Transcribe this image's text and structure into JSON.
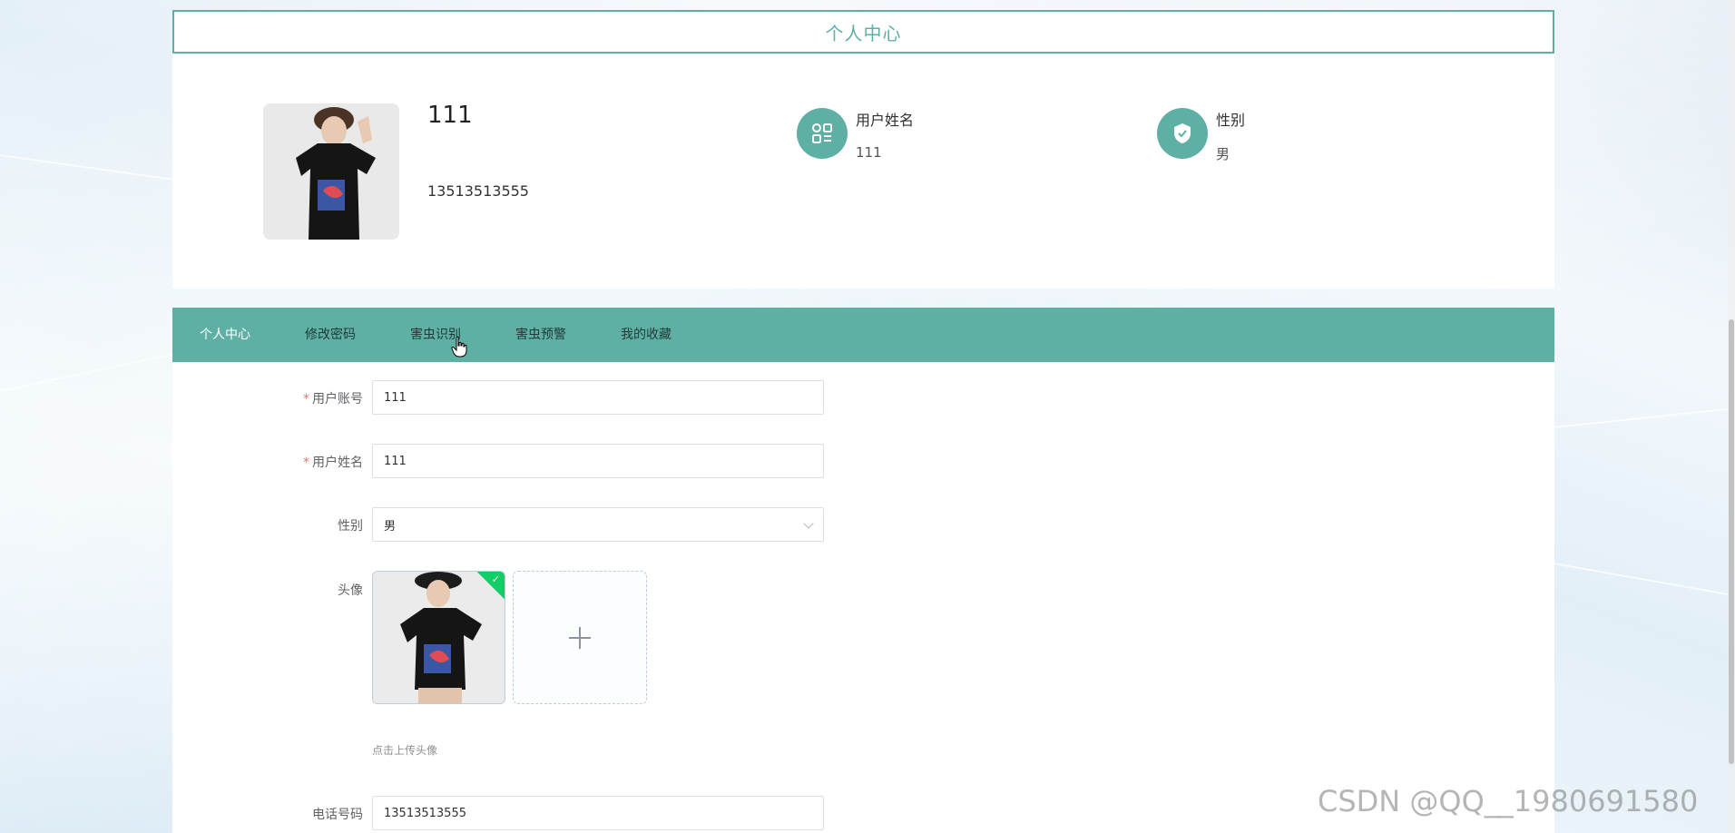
{
  "page": {
    "title": "个人中心"
  },
  "profile": {
    "name": "111",
    "phone": "13513513555",
    "info": [
      {
        "label": "用户姓名",
        "value": "111",
        "icon": "grid-icon"
      },
      {
        "label": "性别",
        "value": "男",
        "icon": "shield-check-icon"
      }
    ]
  },
  "tabs": [
    {
      "label": "个人中心",
      "active": true
    },
    {
      "label": "修改密码",
      "active": false
    },
    {
      "label": "害虫识别",
      "active": false
    },
    {
      "label": "害虫预警",
      "active": false
    },
    {
      "label": "我的收藏",
      "active": false
    }
  ],
  "form": {
    "account_label": "用户账号",
    "account_value": "111",
    "name_label": "用户姓名",
    "name_value": "111",
    "gender_label": "性别",
    "gender_value": "男",
    "avatar_label": "头像",
    "avatar_tip": "点击上传头像",
    "phone_label": "电话号码",
    "phone_value": "13513513555",
    "required_mark": "*"
  },
  "watermark": "CSDN @QQ__1980691580",
  "colors": {
    "primary": "#5fb0a4",
    "required": "#f56c6c",
    "upload_success": "#13ce66"
  }
}
